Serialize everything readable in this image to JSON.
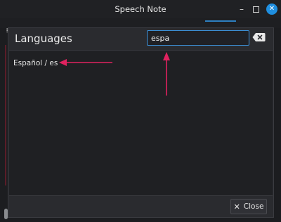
{
  "window": {
    "title": "Speech Note",
    "minimize_icon": "minimize-icon",
    "maximize_icon": "maximize-icon",
    "close_icon": "close-icon"
  },
  "dialog": {
    "title": "Languages",
    "search": {
      "value": "espa",
      "placeholder": ""
    },
    "clear_icon": "backspace-clear-icon",
    "items": [
      {
        "label": "Español / es"
      }
    ],
    "close_button": {
      "label": "Close",
      "icon": "close-x-icon"
    }
  },
  "colors": {
    "accent": "#3c8fd6",
    "window_close": "#1f8fe0",
    "annotation_arrow": "#e0225f"
  }
}
